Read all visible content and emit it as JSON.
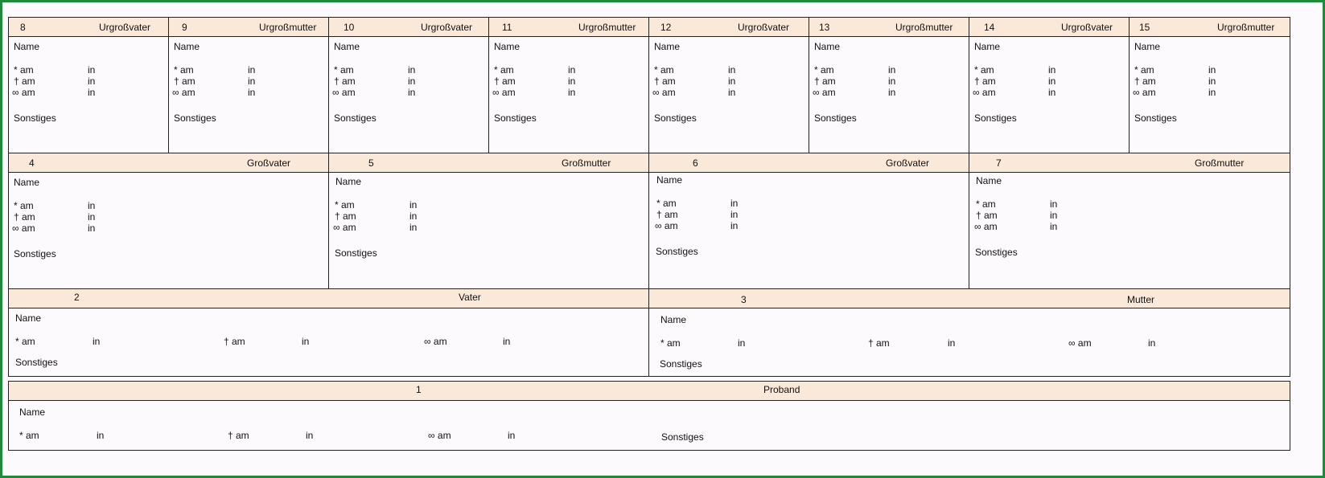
{
  "labels": {
    "name": "Name",
    "born": "* am",
    "died": "† am",
    "married": "∞ am",
    "in": "in",
    "other": "Sonstiges"
  },
  "great_grandparents": [
    {
      "num": "8",
      "role": "Urgroßvater"
    },
    {
      "num": "9",
      "role": "Urgroßmutter"
    },
    {
      "num": "10",
      "role": "Urgroßvater"
    },
    {
      "num": "11",
      "role": "Urgroßmutter"
    },
    {
      "num": "12",
      "role": "Urgroßvater"
    },
    {
      "num": "13",
      "role": "Urgroßmutter"
    },
    {
      "num": "14",
      "role": "Urgroßvater"
    },
    {
      "num": "15",
      "role": "Urgroßmutter"
    }
  ],
  "grandparents": [
    {
      "num": "4",
      "role": "Großvater"
    },
    {
      "num": "5",
      "role": "Großmutter"
    },
    {
      "num": "6",
      "role": "Großvater"
    },
    {
      "num": "7",
      "role": "Großmutter"
    }
  ],
  "parents": [
    {
      "num": "2",
      "role": "Vater"
    },
    {
      "num": "3",
      "role": "Mutter"
    }
  ],
  "proband": {
    "num": "1",
    "role": "Proband"
  }
}
